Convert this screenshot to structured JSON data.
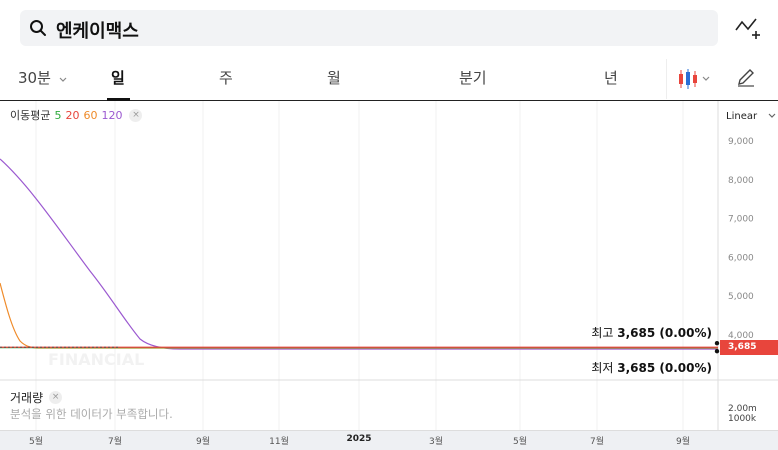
{
  "search": {
    "title": "엔케이맥스"
  },
  "tabs": {
    "interval": "30분",
    "items": [
      "일",
      "주",
      "월",
      "분기",
      "년"
    ],
    "active_index": 0
  },
  "legend": {
    "label": "이동평균",
    "ma": [
      {
        "period": "5",
        "color": "#2eaa3d"
      },
      {
        "period": "20",
        "color": "#e8453c"
      },
      {
        "period": "60",
        "color": "#ef8b2a"
      },
      {
        "period": "120",
        "color": "#9b59d0"
      }
    ],
    "close_glyph": "×"
  },
  "scale": {
    "label": "Linear"
  },
  "yaxis": {
    "ticks": [
      "9,000",
      "8,000",
      "7,000",
      "6,000",
      "5,000",
      "4,000"
    ],
    "values": [
      9000,
      8000,
      7000,
      6000,
      5000,
      4000
    ]
  },
  "markers": {
    "high_label": "최고",
    "high_value": "3,685 (0.00%)",
    "low_label": "최저",
    "low_value": "3,685 (0.00%)",
    "current_price": "3,685"
  },
  "volume": {
    "title": "거래량",
    "message": "분석을 위한 데이터가 부족합니다.",
    "axis": [
      "2.00m",
      "1000k"
    ]
  },
  "xaxis": {
    "ticks": [
      "5월",
      "7월",
      "9월",
      "11월",
      "2025",
      "3월",
      "5월",
      "7월",
      "9월"
    ]
  },
  "watermark": "FINANCIAL",
  "colors": {
    "price_line": "#e8453c",
    "accent": "#e8453c"
  }
}
